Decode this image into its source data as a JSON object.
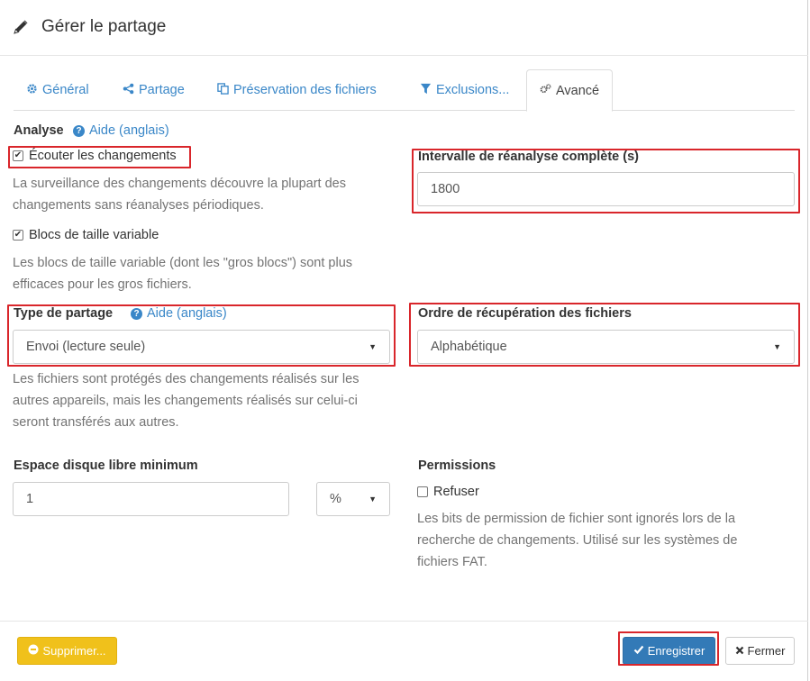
{
  "dialog": {
    "title": "Gérer le partage"
  },
  "tabs": [
    {
      "label": "Général",
      "icon": "gear-icon"
    },
    {
      "label": "Partage",
      "icon": "share-icon"
    },
    {
      "label": "Préservation des fichiers",
      "icon": "copy-icon"
    },
    {
      "label": "Exclusions...",
      "icon": "filter-icon"
    },
    {
      "label": "Avancé",
      "icon": "gears-icon",
      "active": true
    }
  ],
  "analysis": {
    "label": "Analyse",
    "help": "Aide (anglais)",
    "watch_label": "Écouter les changements",
    "watch_checked": true,
    "watch_desc_1": "La surveillance des changements découvre la plupart des",
    "watch_desc_2": "changements sans réanalyses périodiques.",
    "variable_label": "Blocs de taille variable",
    "variable_checked": true,
    "variable_desc_1": "Les blocs de taille variable (dont les \"gros blocs\") sont plus",
    "variable_desc_2": "efficaces pour les gros fichiers."
  },
  "rescan": {
    "label": "Intervalle de réanalyse complète (s)",
    "value": "1800"
  },
  "folder_type": {
    "label": "Type de partage",
    "help": "Aide (anglais)",
    "value": "Envoi (lecture seule)",
    "desc_1": "Les fichiers sont protégés des changements réalisés sur les",
    "desc_2": "autres appareils, mais les changements réalisés sur celui-ci",
    "desc_3": "seront transférés aux autres."
  },
  "pull_order": {
    "label": "Ordre de récupération des fichiers",
    "value": "Alphabétique"
  },
  "min_disk": {
    "label": "Espace disque libre minimum",
    "value": "1",
    "unit": "%"
  },
  "permissions": {
    "label": "Permissions",
    "ignore_label": "Refuser",
    "ignore_checked": false,
    "desc_1": "Les bits de permission de fichier sont ignorés lors de la",
    "desc_2": "recherche de changements. Utilisé sur les systèmes de",
    "desc_3": "fichiers FAT."
  },
  "footer": {
    "delete": "Supprimer...",
    "save": "Enregistrer",
    "close": "Fermer"
  },
  "colors": {
    "accent": "#337ab7",
    "link": "#3a87c8",
    "warning": "#f0c11b",
    "highlight": "#d9262b"
  }
}
